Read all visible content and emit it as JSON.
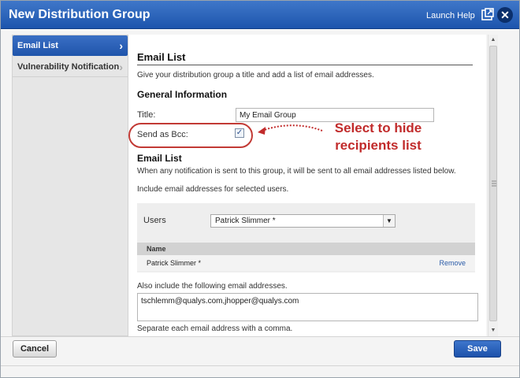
{
  "dialog": {
    "title": "New Distribution Group",
    "launch_help": "Launch Help",
    "close_glyph": "✕"
  },
  "sidebar": {
    "items": [
      {
        "label": "Email List",
        "active": true
      },
      {
        "label": "Vulnerability Notification",
        "active": false
      }
    ],
    "chevron": "›"
  },
  "content": {
    "section_title": "Email List",
    "description": "Give your distribution group a title and add a list of email addresses.",
    "general_heading": "General Information",
    "title_label": "Title:",
    "title_value": "My Email Group",
    "bcc_label": "Send as Bcc:",
    "bcc_checked": true,
    "bcc_check_glyph": "✓",
    "annotation": "Select to hide recipients list",
    "email_list_heading": "Email List",
    "email_list_desc": "When any notification is sent to this group, it will be sent to all email addresses listed below.",
    "include_desc": "Include email addresses for selected users.",
    "users_label": "Users",
    "users_selected": "Patrick Slimmer *",
    "users_dropdown_glyph": "▼",
    "table_header": "Name",
    "table_rows": [
      {
        "name": "Patrick Slimmer *",
        "action": "Remove"
      }
    ],
    "also_desc": "Also include the following email addresses.",
    "email_addresses": "tschlemm@qualys.com,jhopper@qualys.com",
    "separate_desc": "Separate each email address with a comma."
  },
  "scrollbar": {
    "up_glyph": "▲",
    "down_glyph": "▼"
  },
  "footer": {
    "cancel_label": "Cancel",
    "save_label": "Save"
  },
  "colors": {
    "titlebar": "#2a63bb",
    "accent_red": "#c12b2b",
    "link": "#2a5ba8"
  },
  "icons": {
    "popout": "popout-window-icon",
    "close": "close-icon",
    "chevron": "chevron-right-icon",
    "check": "check-icon",
    "dropdown": "chevron-down-icon"
  }
}
